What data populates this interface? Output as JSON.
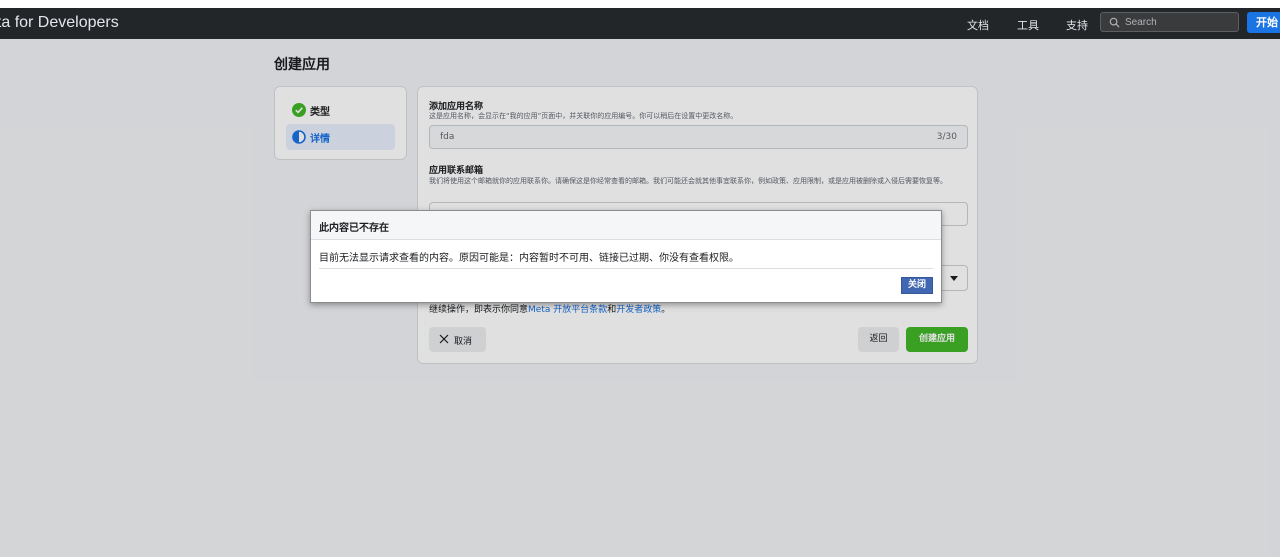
{
  "nav": {
    "brand": "eta for Developers",
    "links": [
      "文档",
      "工具",
      "支持"
    ],
    "search_placeholder": "Search",
    "start_label": "开始"
  },
  "page": {
    "title": "创建应用"
  },
  "steps": [
    {
      "label": "类型",
      "status": "complete",
      "icon": "check-circle-icon"
    },
    {
      "label": "详情",
      "status": "current",
      "icon": "half-circle-icon"
    }
  ],
  "form": {
    "app_name_label": "添加应用名称",
    "app_name_help": "这是应用名称，会显示在“我的应用”页面中，并关联你的应用编号。你可以稍后在设置中更改名称。",
    "app_name_value": "fda",
    "app_name_count": "3/30",
    "email_label": "应用联系邮箱",
    "email_help": "我们将使用这个邮箱就你的应用联系你。请确保这是你经常查看的邮箱。我们可能还会就其他事宜联系你，例如政策、应用限制，或是应用被删除或入侵后需要恢复等。",
    "terms_prefix": "继续操作，即表示你同意",
    "terms_link1": "Meta 开放平台条款",
    "terms_and": "和",
    "terms_link2": "开发者政策",
    "terms_suffix": "。",
    "cancel_label": "取消",
    "back_label": "返回",
    "create_label": "创建应用"
  },
  "dialog": {
    "title": "此内容已不存在",
    "message": "目前无法显示请求查看的内容。原因可能是：内容暂时不可用、链接已过期、你没有查看权限。",
    "close_label": "关闭"
  },
  "colors": {
    "nav_bg": "#232629",
    "primary": "#1b74e4",
    "create_green": "#42b72a",
    "dialog_button": "#4267b2"
  }
}
